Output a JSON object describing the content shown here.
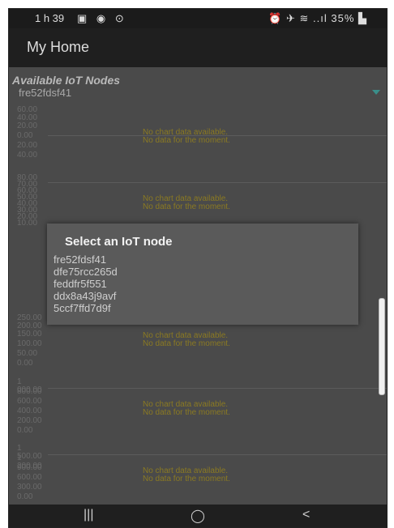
{
  "status_bar": {
    "time": "1 h 39",
    "left_icons": "▣ ◉ ⊙",
    "right_icons": "⏰ ✈ ≋ ..ıl",
    "battery": "35% ▙"
  },
  "app": {
    "title": "My Home"
  },
  "node_selector": {
    "label": "Available IoT Nodes",
    "selected": "fre52fdsf41"
  },
  "charts": [
    {
      "ticks": [
        "60.00",
        "40.00",
        "20.00",
        "0.00",
        "20.00",
        "40.00"
      ],
      "no_data_1": "No chart data available.",
      "no_data_2": "No data for the moment."
    },
    {
      "ticks": [
        "80.00",
        "70.00",
        "60.00",
        "50.00",
        "40.00",
        "30.00",
        "20.00",
        "10.00"
      ],
      "no_data_1": "No chart data available.",
      "no_data_2": "No data for the moment."
    },
    {
      "ticks": [
        "250.00",
        "200.00",
        "150.00",
        "100.00",
        "50.00",
        "0.00"
      ],
      "no_data_1": "No chart data available.",
      "no_data_2": "No data for the moment."
    },
    {
      "ticks": [
        "1 000.00",
        "800.00",
        "600.00",
        "400.00",
        "200.00",
        "0.00"
      ],
      "no_data_1": "No chart data available.",
      "no_data_2": "No data for the moment."
    },
    {
      "ticks": [
        "1 500.00",
        "1 200.00",
        "900.00",
        "600.00",
        "300.00",
        "0.00"
      ],
      "no_data_1": "No chart data available.",
      "no_data_2": "No data for the moment."
    }
  ],
  "dialog": {
    "title": "Select an IoT node",
    "options": [
      "fre52fdsf41",
      "dfe75rcc265d",
      "feddfr5f551",
      "ddx8a43j9avf",
      "5ccf7ffd7d9f"
    ]
  },
  "nav_bar": {
    "recents": "|||",
    "home": "◯",
    "back": "<"
  }
}
